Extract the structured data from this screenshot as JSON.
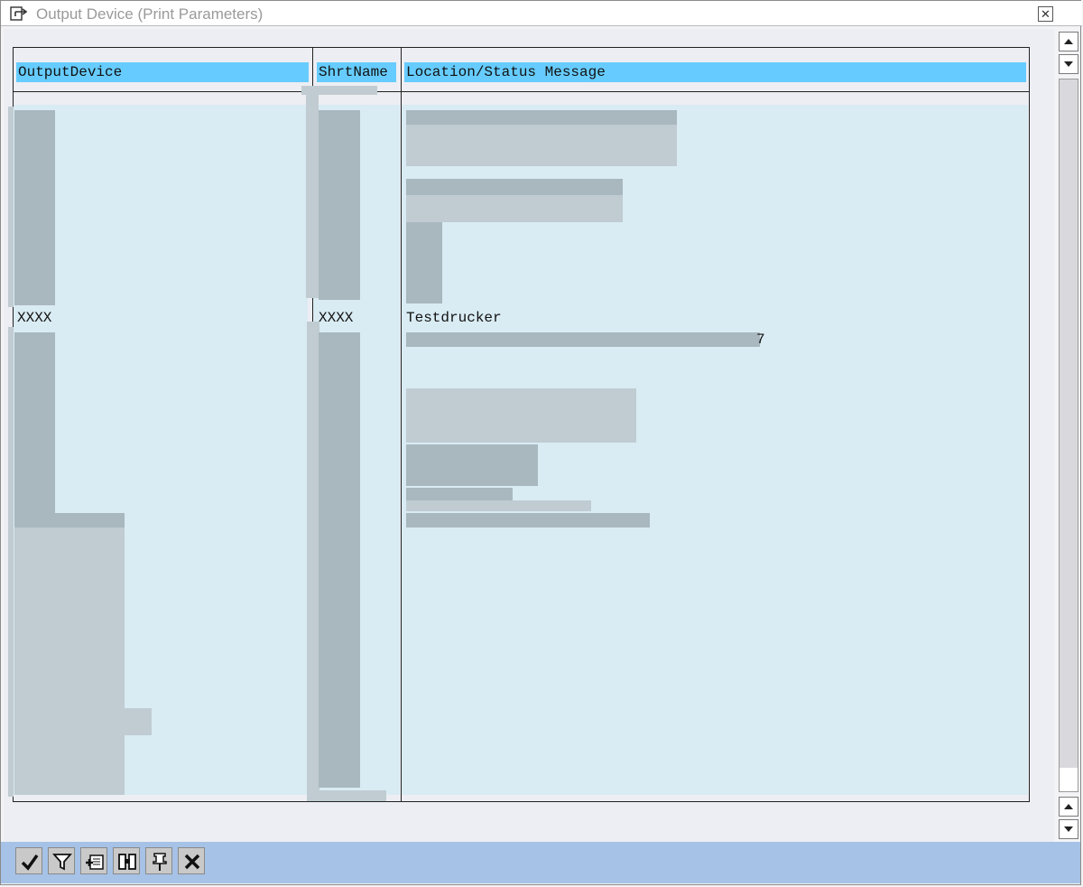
{
  "window": {
    "title": "Output Device (Print Parameters)"
  },
  "table": {
    "columns": [
      "OutputDevice",
      "ShrtName",
      "Location/Status Message"
    ],
    "visible_row": {
      "output_device": "XXXX",
      "short_name": "XXXX",
      "location_status": "Testdrucker"
    },
    "partial_text": "7"
  },
  "toolbar": {
    "buttons": [
      "continue",
      "filter",
      "new-entry",
      "find",
      "pin",
      "cancel"
    ]
  },
  "colors": {
    "header_highlight": "#66ccff",
    "row_background": "#d9ebf3",
    "footer_bar": "#a6c2e6"
  }
}
